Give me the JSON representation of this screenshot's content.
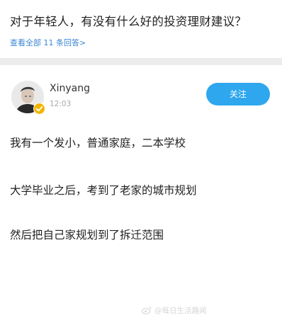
{
  "question": {
    "title": "对于年轻人，有没有什么好的投资理财建议？",
    "view_all": "查看全部 11 条回答>"
  },
  "answer": {
    "author_name": "Xinyang",
    "time": "12:03",
    "follow_label": "关注",
    "paragraphs": [
      "我有一个发小，普通家庭，二本学校",
      "大学毕业之后，考到了老家的城市规划",
      "然后把自己家规划到了拆迁范围"
    ]
  },
  "watermark": {
    "icon": "weibo-icon",
    "text": "@每日生活趣闻"
  },
  "colors": {
    "accent": "#2ea7ee",
    "link": "#3a86d6",
    "verified": "#f4b400"
  }
}
